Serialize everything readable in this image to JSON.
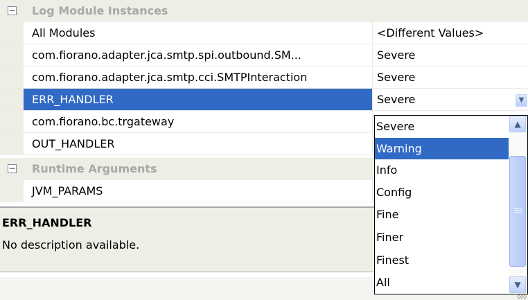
{
  "grid": {
    "categories": [
      {
        "label": "Log Module Instances",
        "toggle": "⊟"
      },
      {
        "label": "Runtime Arguments",
        "toggle": "⊟"
      }
    ],
    "rows": [
      {
        "name": "All Modules",
        "value": "<Different Values>"
      },
      {
        "name": "com.fiorano.adapter.jca.smtp.spi.outbound.SM...",
        "value": "Severe"
      },
      {
        "name": "com.fiorano.adapter.jca.smtp.cci.SMTPInteraction",
        "value": "Severe"
      },
      {
        "name": "ERR_HANDLER",
        "value": "Severe"
      },
      {
        "name": "com.fiorano.bc.trgateway",
        "value": ""
      },
      {
        "name": "OUT_HANDLER",
        "value": ""
      },
      {
        "name": "JVM_PARAMS",
        "value": ""
      }
    ]
  },
  "dropdown": {
    "options": [
      "Severe",
      "Warning",
      "Info",
      "Config",
      "Fine",
      "Finer",
      "Finest",
      "All"
    ],
    "highlighted": "Warning"
  },
  "description": {
    "title": "ERR_HANDLER",
    "text": "No description available."
  },
  "icons": {
    "combo": "chevron-down-icon",
    "scroll_up": "chevron-up-icon",
    "scroll_down": "chevron-down-icon"
  },
  "colors": {
    "selection": "#316ac5",
    "category_bg": "#eeeee6",
    "category_text": "#a8a8a8"
  }
}
